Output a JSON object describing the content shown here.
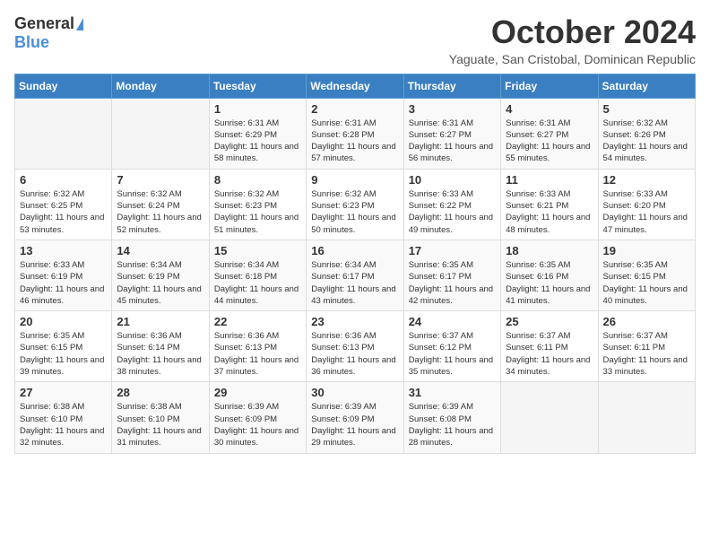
{
  "header": {
    "logo_general": "General",
    "logo_blue": "Blue",
    "month_title": "October 2024",
    "location": "Yaguate, San Cristobal, Dominican Republic"
  },
  "weekdays": [
    "Sunday",
    "Monday",
    "Tuesday",
    "Wednesday",
    "Thursday",
    "Friday",
    "Saturday"
  ],
  "weeks": [
    [
      {
        "day": "",
        "sunrise": "",
        "sunset": "",
        "daylight": ""
      },
      {
        "day": "",
        "sunrise": "",
        "sunset": "",
        "daylight": ""
      },
      {
        "day": "1",
        "sunrise": "Sunrise: 6:31 AM",
        "sunset": "Sunset: 6:29 PM",
        "daylight": "Daylight: 11 hours and 58 minutes."
      },
      {
        "day": "2",
        "sunrise": "Sunrise: 6:31 AM",
        "sunset": "Sunset: 6:28 PM",
        "daylight": "Daylight: 11 hours and 57 minutes."
      },
      {
        "day": "3",
        "sunrise": "Sunrise: 6:31 AM",
        "sunset": "Sunset: 6:27 PM",
        "daylight": "Daylight: 11 hours and 56 minutes."
      },
      {
        "day": "4",
        "sunrise": "Sunrise: 6:31 AM",
        "sunset": "Sunset: 6:27 PM",
        "daylight": "Daylight: 11 hours and 55 minutes."
      },
      {
        "day": "5",
        "sunrise": "Sunrise: 6:32 AM",
        "sunset": "Sunset: 6:26 PM",
        "daylight": "Daylight: 11 hours and 54 minutes."
      }
    ],
    [
      {
        "day": "6",
        "sunrise": "Sunrise: 6:32 AM",
        "sunset": "Sunset: 6:25 PM",
        "daylight": "Daylight: 11 hours and 53 minutes."
      },
      {
        "day": "7",
        "sunrise": "Sunrise: 6:32 AM",
        "sunset": "Sunset: 6:24 PM",
        "daylight": "Daylight: 11 hours and 52 minutes."
      },
      {
        "day": "8",
        "sunrise": "Sunrise: 6:32 AM",
        "sunset": "Sunset: 6:23 PM",
        "daylight": "Daylight: 11 hours and 51 minutes."
      },
      {
        "day": "9",
        "sunrise": "Sunrise: 6:32 AM",
        "sunset": "Sunset: 6:23 PM",
        "daylight": "Daylight: 11 hours and 50 minutes."
      },
      {
        "day": "10",
        "sunrise": "Sunrise: 6:33 AM",
        "sunset": "Sunset: 6:22 PM",
        "daylight": "Daylight: 11 hours and 49 minutes."
      },
      {
        "day": "11",
        "sunrise": "Sunrise: 6:33 AM",
        "sunset": "Sunset: 6:21 PM",
        "daylight": "Daylight: 11 hours and 48 minutes."
      },
      {
        "day": "12",
        "sunrise": "Sunrise: 6:33 AM",
        "sunset": "Sunset: 6:20 PM",
        "daylight": "Daylight: 11 hours and 47 minutes."
      }
    ],
    [
      {
        "day": "13",
        "sunrise": "Sunrise: 6:33 AM",
        "sunset": "Sunset: 6:19 PM",
        "daylight": "Daylight: 11 hours and 46 minutes."
      },
      {
        "day": "14",
        "sunrise": "Sunrise: 6:34 AM",
        "sunset": "Sunset: 6:19 PM",
        "daylight": "Daylight: 11 hours and 45 minutes."
      },
      {
        "day": "15",
        "sunrise": "Sunrise: 6:34 AM",
        "sunset": "Sunset: 6:18 PM",
        "daylight": "Daylight: 11 hours and 44 minutes."
      },
      {
        "day": "16",
        "sunrise": "Sunrise: 6:34 AM",
        "sunset": "Sunset: 6:17 PM",
        "daylight": "Daylight: 11 hours and 43 minutes."
      },
      {
        "day": "17",
        "sunrise": "Sunrise: 6:35 AM",
        "sunset": "Sunset: 6:17 PM",
        "daylight": "Daylight: 11 hours and 42 minutes."
      },
      {
        "day": "18",
        "sunrise": "Sunrise: 6:35 AM",
        "sunset": "Sunset: 6:16 PM",
        "daylight": "Daylight: 11 hours and 41 minutes."
      },
      {
        "day": "19",
        "sunrise": "Sunrise: 6:35 AM",
        "sunset": "Sunset: 6:15 PM",
        "daylight": "Daylight: 11 hours and 40 minutes."
      }
    ],
    [
      {
        "day": "20",
        "sunrise": "Sunrise: 6:35 AM",
        "sunset": "Sunset: 6:15 PM",
        "daylight": "Daylight: 11 hours and 39 minutes."
      },
      {
        "day": "21",
        "sunrise": "Sunrise: 6:36 AM",
        "sunset": "Sunset: 6:14 PM",
        "daylight": "Daylight: 11 hours and 38 minutes."
      },
      {
        "day": "22",
        "sunrise": "Sunrise: 6:36 AM",
        "sunset": "Sunset: 6:13 PM",
        "daylight": "Daylight: 11 hours and 37 minutes."
      },
      {
        "day": "23",
        "sunrise": "Sunrise: 6:36 AM",
        "sunset": "Sunset: 6:13 PM",
        "daylight": "Daylight: 11 hours and 36 minutes."
      },
      {
        "day": "24",
        "sunrise": "Sunrise: 6:37 AM",
        "sunset": "Sunset: 6:12 PM",
        "daylight": "Daylight: 11 hours and 35 minutes."
      },
      {
        "day": "25",
        "sunrise": "Sunrise: 6:37 AM",
        "sunset": "Sunset: 6:11 PM",
        "daylight": "Daylight: 11 hours and 34 minutes."
      },
      {
        "day": "26",
        "sunrise": "Sunrise: 6:37 AM",
        "sunset": "Sunset: 6:11 PM",
        "daylight": "Daylight: 11 hours and 33 minutes."
      }
    ],
    [
      {
        "day": "27",
        "sunrise": "Sunrise: 6:38 AM",
        "sunset": "Sunset: 6:10 PM",
        "daylight": "Daylight: 11 hours and 32 minutes."
      },
      {
        "day": "28",
        "sunrise": "Sunrise: 6:38 AM",
        "sunset": "Sunset: 6:10 PM",
        "daylight": "Daylight: 11 hours and 31 minutes."
      },
      {
        "day": "29",
        "sunrise": "Sunrise: 6:39 AM",
        "sunset": "Sunset: 6:09 PM",
        "daylight": "Daylight: 11 hours and 30 minutes."
      },
      {
        "day": "30",
        "sunrise": "Sunrise: 6:39 AM",
        "sunset": "Sunset: 6:09 PM",
        "daylight": "Daylight: 11 hours and 29 minutes."
      },
      {
        "day": "31",
        "sunrise": "Sunrise: 6:39 AM",
        "sunset": "Sunset: 6:08 PM",
        "daylight": "Daylight: 11 hours and 28 minutes."
      },
      {
        "day": "",
        "sunrise": "",
        "sunset": "",
        "daylight": ""
      },
      {
        "day": "",
        "sunrise": "",
        "sunset": "",
        "daylight": ""
      }
    ]
  ]
}
